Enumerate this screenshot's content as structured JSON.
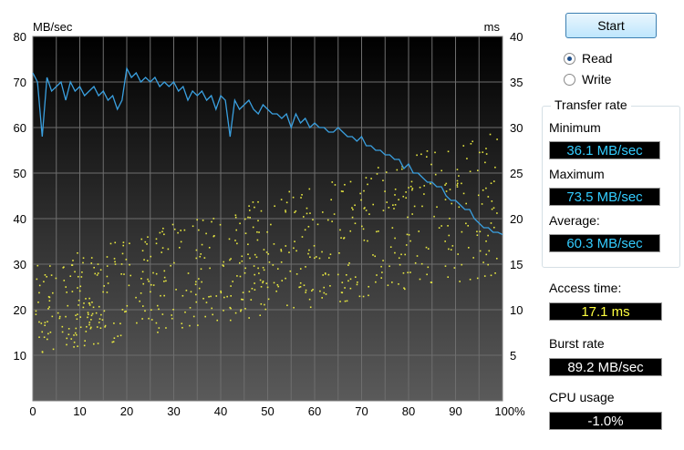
{
  "controls": {
    "start_label": "Start",
    "modes": [
      {
        "label": "Read",
        "selected": true
      },
      {
        "label": "Write",
        "selected": false
      }
    ]
  },
  "transfer_rate": {
    "title": "Transfer rate",
    "minimum_label": "Minimum",
    "minimum_value": "36.1 MB/sec",
    "maximum_label": "Maximum",
    "maximum_value": "73.5 MB/sec",
    "average_label": "Average:",
    "average_value": "60.3 MB/sec"
  },
  "stats": {
    "access_label": "Access time:",
    "access_value": "17.1 ms",
    "burst_label": "Burst rate",
    "burst_value": "89.2 MB/sec",
    "cpu_label": "CPU usage",
    "cpu_value": "-1.0%"
  },
  "colors": {
    "transfer_line": "#3aa0e0",
    "access_points": "#e8e840",
    "value_text": "#33ccff",
    "access_text": "#ffff40"
  },
  "chart_data": {
    "type": "line",
    "y_left_label": "MB/sec",
    "y_right_label": "ms",
    "x_unit": "%",
    "xlim": [
      0,
      100
    ],
    "ylim_left": [
      0,
      80
    ],
    "ylim_right": [
      0,
      40
    ],
    "x_ticks": [
      "0",
      "10",
      "20",
      "30",
      "40",
      "50",
      "60",
      "70",
      "80",
      "90",
      "100%"
    ],
    "y_left_ticks": [
      "10",
      "20",
      "30",
      "40",
      "50",
      "60",
      "70",
      "80"
    ],
    "y_right_ticks": [
      "5",
      "10",
      "15",
      "20",
      "25",
      "30",
      "35",
      "40"
    ],
    "grid": true,
    "series": [
      {
        "name": "Transfer rate",
        "axis": "left",
        "x": [
          0,
          1,
          2,
          3,
          4,
          5,
          6,
          7,
          8,
          9,
          10,
          11,
          12,
          13,
          14,
          15,
          16,
          17,
          18,
          19,
          20,
          21,
          22,
          23,
          24,
          25,
          26,
          27,
          28,
          29,
          30,
          31,
          32,
          33,
          34,
          35,
          36,
          37,
          38,
          39,
          40,
          41,
          42,
          43,
          44,
          45,
          46,
          47,
          48,
          49,
          50,
          51,
          52,
          53,
          54,
          55,
          56,
          57,
          58,
          59,
          60,
          61,
          62,
          63,
          64,
          65,
          66,
          67,
          68,
          69,
          70,
          71,
          72,
          73,
          74,
          75,
          76,
          77,
          78,
          79,
          80,
          81,
          82,
          83,
          84,
          85,
          86,
          87,
          88,
          89,
          90,
          91,
          92,
          93,
          94,
          95,
          96,
          97,
          98,
          99,
          100
        ],
        "values": [
          72,
          70,
          58,
          71,
          68,
          69,
          70,
          66,
          70,
          68,
          69,
          67,
          68,
          69,
          67,
          68,
          66,
          67,
          64,
          66,
          73,
          71,
          72,
          70,
          71,
          70,
          71,
          69,
          70,
          69,
          70,
          68,
          69,
          66,
          68,
          67,
          68,
          66,
          67,
          64,
          67,
          66,
          58,
          66,
          64,
          65,
          66,
          64,
          63,
          65,
          64,
          63,
          63,
          62,
          63,
          60,
          63,
          61,
          62,
          60,
          61,
          60,
          60,
          59,
          59,
          60,
          59,
          58,
          58,
          57,
          58,
          56,
          56,
          55,
          55,
          54,
          54,
          53,
          53,
          51,
          52,
          50,
          50,
          49,
          48,
          48,
          47,
          47,
          45,
          44,
          44,
          43,
          42,
          42,
          40,
          39,
          38,
          38,
          37,
          37,
          36.5
        ]
      },
      {
        "name": "Access time",
        "axis": "right",
        "style": "scatter"
      }
    ]
  }
}
